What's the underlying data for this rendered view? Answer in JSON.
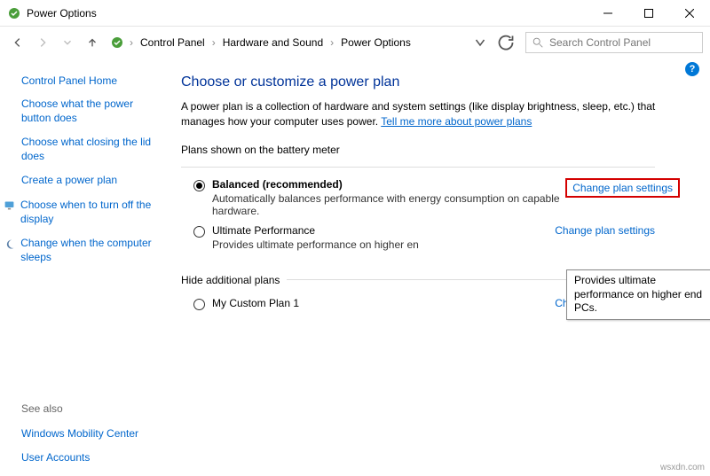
{
  "window": {
    "title": "Power Options"
  },
  "breadcrumbs": {
    "a": "Control Panel",
    "b": "Hardware and Sound",
    "c": "Power Options"
  },
  "search": {
    "placeholder": "Search Control Panel"
  },
  "sidebar": {
    "home": "Control Panel Home",
    "l1": "Choose what the power button does",
    "l2": "Choose what closing the lid does",
    "l3": "Create a power plan",
    "l4": "Choose when to turn off the display",
    "l5": "Change when the computer sleeps",
    "see_also": "See also",
    "s1": "Windows Mobility Center",
    "s2": "User Accounts"
  },
  "main": {
    "heading": "Choose or customize a power plan",
    "desc_a": "A power plan is a collection of hardware and system settings (like display brightness, sleep, etc.) that manages how your computer uses power. ",
    "desc_link": "Tell me more about power plans",
    "section1": "Plans shown on the battery meter",
    "plan_balanced": {
      "name": "Balanced (recommended)",
      "sub": "Automatically balances performance with energy consumption on capable hardware.",
      "link": "Change plan settings"
    },
    "plan_ultimate": {
      "name": "Ultimate Performance",
      "sub": "Provides ultimate performance on higher en",
      "link": "Change plan settings"
    },
    "tooltip": "Provides ultimate performance on higher end PCs.",
    "section2": "Hide additional plans",
    "plan_custom": {
      "name": "My Custom Plan 1",
      "link": "Change plan settings"
    }
  },
  "help": "?",
  "watermark": "wsxdn.com"
}
